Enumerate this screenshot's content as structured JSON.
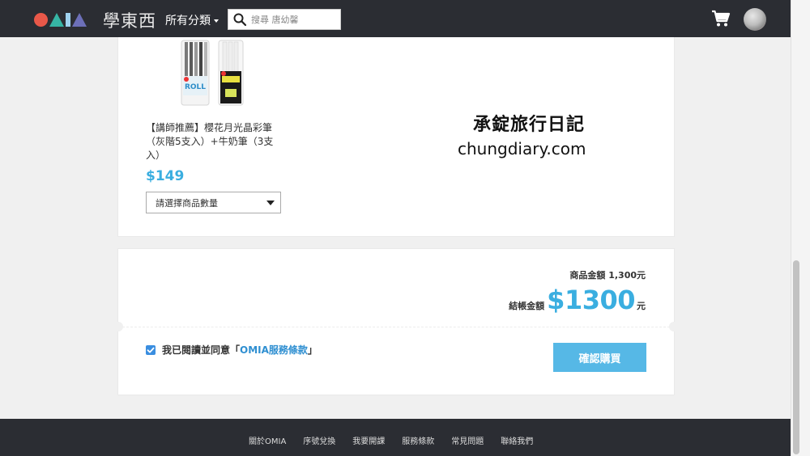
{
  "header": {
    "brand_text": "學東西",
    "category_label": "所有分類",
    "search_placeholder": "搜尋 唐幼馨"
  },
  "product": {
    "title": "【講師推薦】櫻花月光晶彩筆（灰階5支入）+牛奶筆（3支入）",
    "price": "$149",
    "quantity_select_label": "請選擇商品數量"
  },
  "watermark": {
    "line1": "承錠旅行日記",
    "line2": "chungdiary.com"
  },
  "summary": {
    "subtotal_text": "商品金額 1,300元",
    "total_label": "結帳金額",
    "total_value": "$1300",
    "total_unit": "元"
  },
  "agreement": {
    "text_prefix": "我已閱讀並同意「",
    "link_text": "OMIA服務條款",
    "text_suffix": "」",
    "checked": true
  },
  "confirm_button_label": "確認購買",
  "footer": {
    "links": [
      "關於OMIA",
      "序號兌換",
      "我要開課",
      "服務條款",
      "常見問題",
      "聯絡我們"
    ]
  },
  "colors": {
    "accent": "#3aaee0",
    "nav_bg": "#2b2d33",
    "button_bg": "#56b8e6",
    "checkbox": "#3a8ee0"
  },
  "icons": [
    "search-icon",
    "cart-icon",
    "checkmark-icon",
    "caret-down-icon"
  ]
}
